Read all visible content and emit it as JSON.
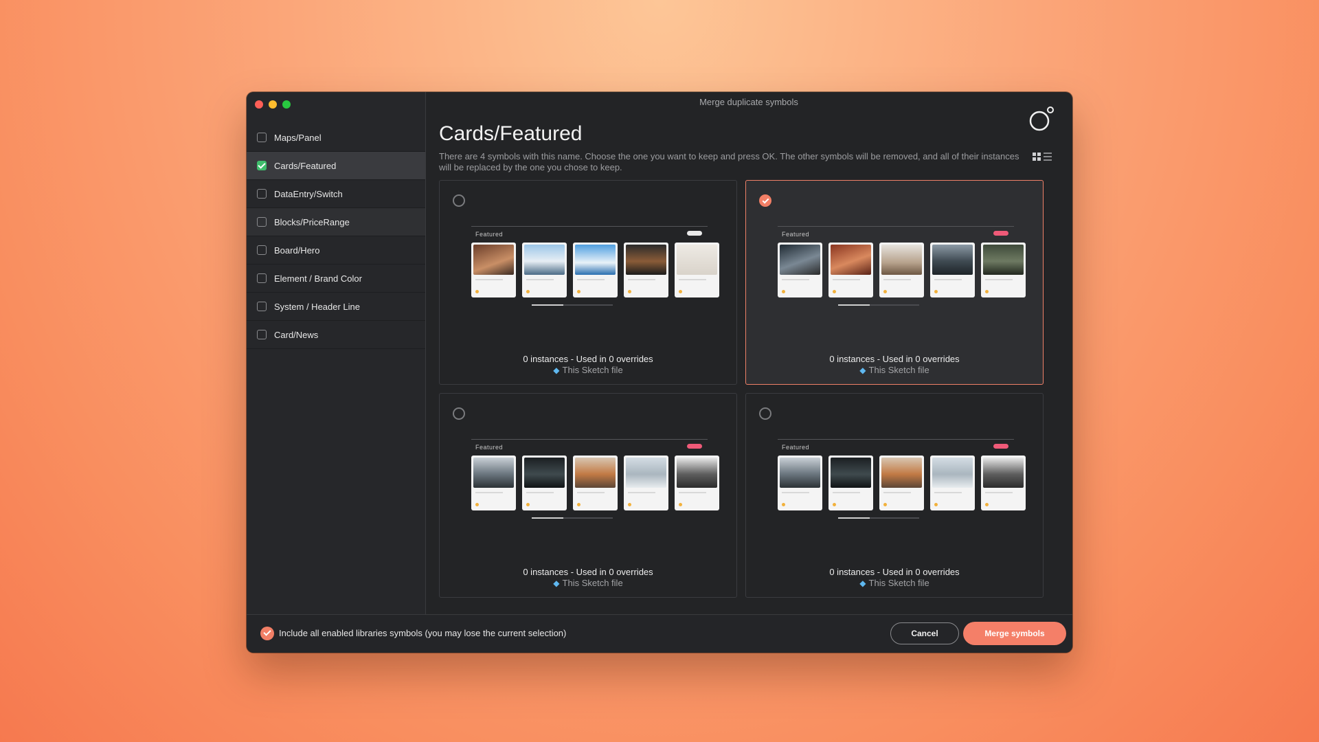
{
  "window": {
    "title": "Merge duplicate symbols"
  },
  "sidebar": {
    "items": [
      {
        "label": "Maps/Panel",
        "checked": false
      },
      {
        "label": "Cards/Featured",
        "checked": true
      },
      {
        "label": "DataEntry/Switch",
        "checked": false
      },
      {
        "label": "Blocks/PriceRange",
        "checked": false
      },
      {
        "label": "Board/Hero",
        "checked": false
      },
      {
        "label": "Element / Brand Color",
        "checked": false
      },
      {
        "label": "System / Header Line",
        "checked": false
      },
      {
        "label": "Card/News",
        "checked": false
      }
    ]
  },
  "main": {
    "title": "Cards/Featured",
    "description": "There are 4 symbols with this name. Choose the one you want to keep and press OK. The other symbols will be removed, and all of their instances will be replaced by the one you chose to keep.",
    "cards": [
      {
        "selected": false,
        "preview_label": "Featured",
        "instances": "0 instances - Used in 0 overrides",
        "source": "This Sketch file"
      },
      {
        "selected": true,
        "preview_label": "Featured",
        "instances": "0 instances - Used in 0 overrides",
        "source": "This Sketch file"
      },
      {
        "selected": false,
        "preview_label": "Featured",
        "instances": "0 instances - Used in 0 overrides",
        "source": "This Sketch file"
      },
      {
        "selected": false,
        "preview_label": "Featured",
        "instances": "0 instances - Used in 0 overrides",
        "source": "This Sketch file"
      }
    ]
  },
  "footer": {
    "include_label": "Include all enabled libraries symbols (you may lose the current selection)",
    "include_checked": true,
    "cancel_label": "Cancel",
    "merge_label": "Merge symbols"
  },
  "colors": {
    "accent": "#f27f66",
    "checked_green": "#3fbd6c",
    "window_bg": "#232426"
  },
  "icons": {
    "logo": "sketch-runner-logo-icon",
    "source": "sketch-diamond-icon",
    "view_grid": "grid-view-icon",
    "view_list": "list-view-icon"
  }
}
